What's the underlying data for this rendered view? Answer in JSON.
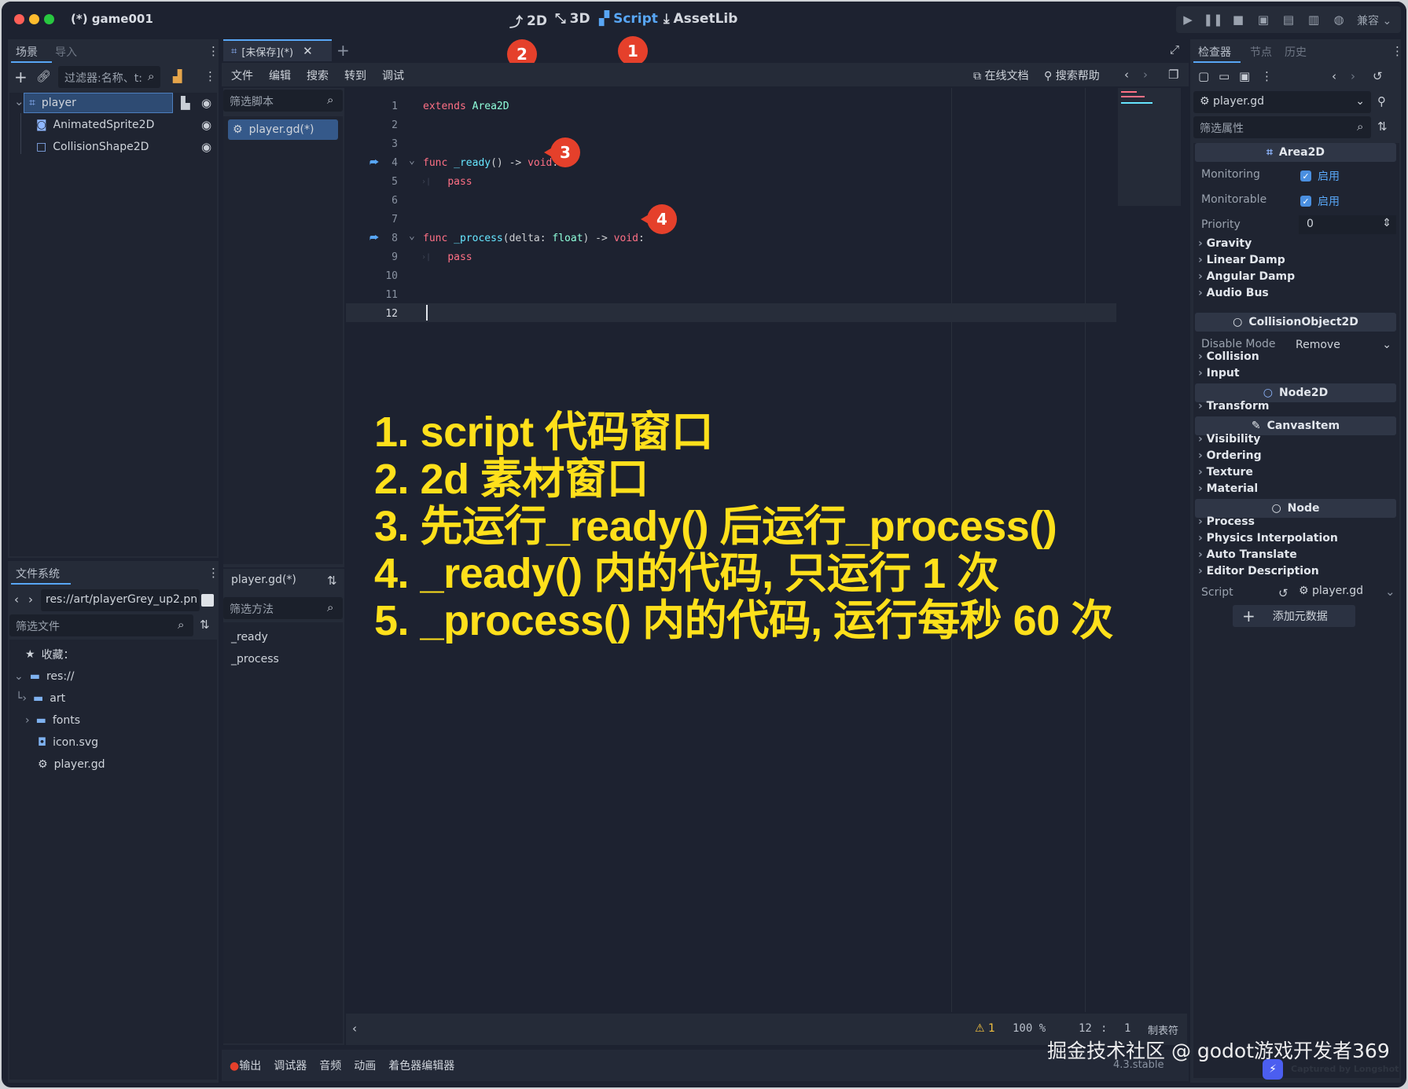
{
  "window": {
    "title": "(*) game001"
  },
  "modes": [
    {
      "label": "2D",
      "icon": "2d-icon"
    },
    {
      "label": "3D",
      "icon": "3d-icon"
    },
    {
      "label": "Script",
      "icon": "script-icon",
      "active": true
    },
    {
      "label": "AssetLib",
      "icon": "download-icon"
    }
  ],
  "run_toolbar": {
    "renderer_label": "兼容"
  },
  "scene_dock": {
    "tabs": [
      "场景",
      "导入"
    ],
    "filter_placeholder": "过滤器:名称、t:",
    "tree": [
      {
        "label": "player",
        "icon": "area2d-icon",
        "selected": true
      },
      {
        "label": "AnimatedSprite2D",
        "icon": "sprite-icon"
      },
      {
        "label": "CollisionShape2D",
        "icon": "collision-shape-icon"
      }
    ]
  },
  "filesystem_dock": {
    "tab": "文件系统",
    "path": "res://art/playerGrey_up2.pn",
    "filter_placeholder": "筛选文件",
    "items": [
      {
        "label": "收藏：",
        "icon": "star-icon"
      },
      {
        "label": "res://",
        "icon": "folder-icon"
      },
      {
        "label": "art",
        "icon": "folder-icon"
      },
      {
        "label": "fonts",
        "icon": "folder-icon"
      },
      {
        "label": "icon.svg",
        "icon": "image-icon"
      },
      {
        "label": "player.gd",
        "icon": "gear-icon"
      }
    ]
  },
  "script_editor": {
    "tab_label": "[未保存](*)",
    "menu": [
      "文件",
      "编辑",
      "搜索",
      "转到",
      "调试"
    ],
    "online_docs": "在线文档",
    "search_help": "搜索帮助",
    "filter_scripts_placeholder": "筛选脚本",
    "scripts": [
      "player.gd(*)"
    ],
    "current_script": "player.gd(*)",
    "filter_methods_placeholder": "筛选方法",
    "methods": [
      "_ready",
      "_process"
    ],
    "code_lines": [
      {
        "n": "1",
        "tokens": [
          [
            "kw",
            "extends"
          ],
          [
            "tx",
            " "
          ],
          [
            "ty",
            "Area2D"
          ]
        ]
      },
      {
        "n": "2",
        "tokens": []
      },
      {
        "n": "3",
        "tokens": []
      },
      {
        "n": "4",
        "tokens": [
          [
            "kw",
            "func"
          ],
          [
            "tx",
            " "
          ],
          [
            "fn",
            "_ready"
          ],
          [
            "tx",
            "() -> "
          ],
          [
            "kw",
            "void"
          ],
          [
            "tx",
            ":"
          ]
        ],
        "fold": true,
        "signal": true
      },
      {
        "n": "5",
        "tokens": [
          [
            "tx",
            "    "
          ],
          [
            "kw",
            "pass"
          ]
        ],
        "indent": true
      },
      {
        "n": "6",
        "tokens": []
      },
      {
        "n": "7",
        "tokens": []
      },
      {
        "n": "8",
        "tokens": [
          [
            "kw",
            "func"
          ],
          [
            "tx",
            " "
          ],
          [
            "fn",
            "_process"
          ],
          [
            "tx",
            "(delta: "
          ],
          [
            "ty",
            "float"
          ],
          [
            "tx",
            ") -> "
          ],
          [
            "kw",
            "void"
          ],
          [
            "tx",
            ":"
          ]
        ],
        "fold": true,
        "signal": true
      },
      {
        "n": "9",
        "tokens": [
          [
            "tx",
            "    "
          ],
          [
            "kw",
            "pass"
          ]
        ],
        "indent": true
      },
      {
        "n": "10",
        "tokens": []
      },
      {
        "n": "11",
        "tokens": []
      },
      {
        "n": "12",
        "tokens": [],
        "current": true
      }
    ],
    "status": {
      "warnings": "1",
      "zoom": "100 %",
      "cursor_line": "12",
      "cursor_col": "1",
      "indent_mode": "制表符"
    }
  },
  "annotations": {
    "badges": [
      "1",
      "2",
      "3",
      "4"
    ],
    "overlay_lines": [
      "1. script 代码窗口",
      "2. 2d  素材窗口",
      "3. 先运行_ready()  后运行_process()",
      "4. _ready() 内的代码, 只运行 1 次",
      "5. _process() 内的代码,  运行每秒 60 次"
    ]
  },
  "bottom_panel": {
    "tabs": [
      "输出",
      "调试器",
      "音频",
      "动画",
      "着色器编辑器"
    ],
    "version": "4.3.stable"
  },
  "inspector": {
    "tabs": [
      "检查器",
      "节点",
      "历史"
    ],
    "resource": "player.gd",
    "filter_placeholder": "筛选属性",
    "area2d_header": "Area2D",
    "monitoring_label": "Monitoring",
    "monitoring_value": "启用",
    "monitorable_label": "Monitorable",
    "monitorable_value": "启用",
    "priority_label": "Priority",
    "priority_value": "0",
    "area_sections": [
      "Gravity",
      "Linear Damp",
      "Angular Damp",
      "Audio Bus"
    ],
    "collision_header": "CollisionObject2D",
    "disable_mode_label": "Disable Mode",
    "disable_mode_value": "Remove",
    "collision_sections": [
      "Collision",
      "Input"
    ],
    "node2d_header": "Node2D",
    "node2d_sections": [
      "Transform"
    ],
    "canvas_header": "CanvasItem",
    "canvas_sections": [
      "Visibility",
      "Ordering",
      "Texture",
      "Material"
    ],
    "node_header": "Node",
    "node_sections": [
      "Process",
      "Physics Interpolation",
      "Auto Translate",
      "Editor Description"
    ],
    "script_label": "Script",
    "script_value": "player.gd",
    "add_metadata": "添加元数据"
  },
  "watermark": {
    "text": "掘金技术社区 @ godot游戏开发者369",
    "capture": "Captured by Longshot"
  },
  "colors": {
    "accent": "#58a6f5",
    "badge": "#e5402b",
    "overlay_text": "#ffe01b",
    "keyword": "#ff7085",
    "function": "#66e6ff",
    "type": "#8fffdb"
  }
}
